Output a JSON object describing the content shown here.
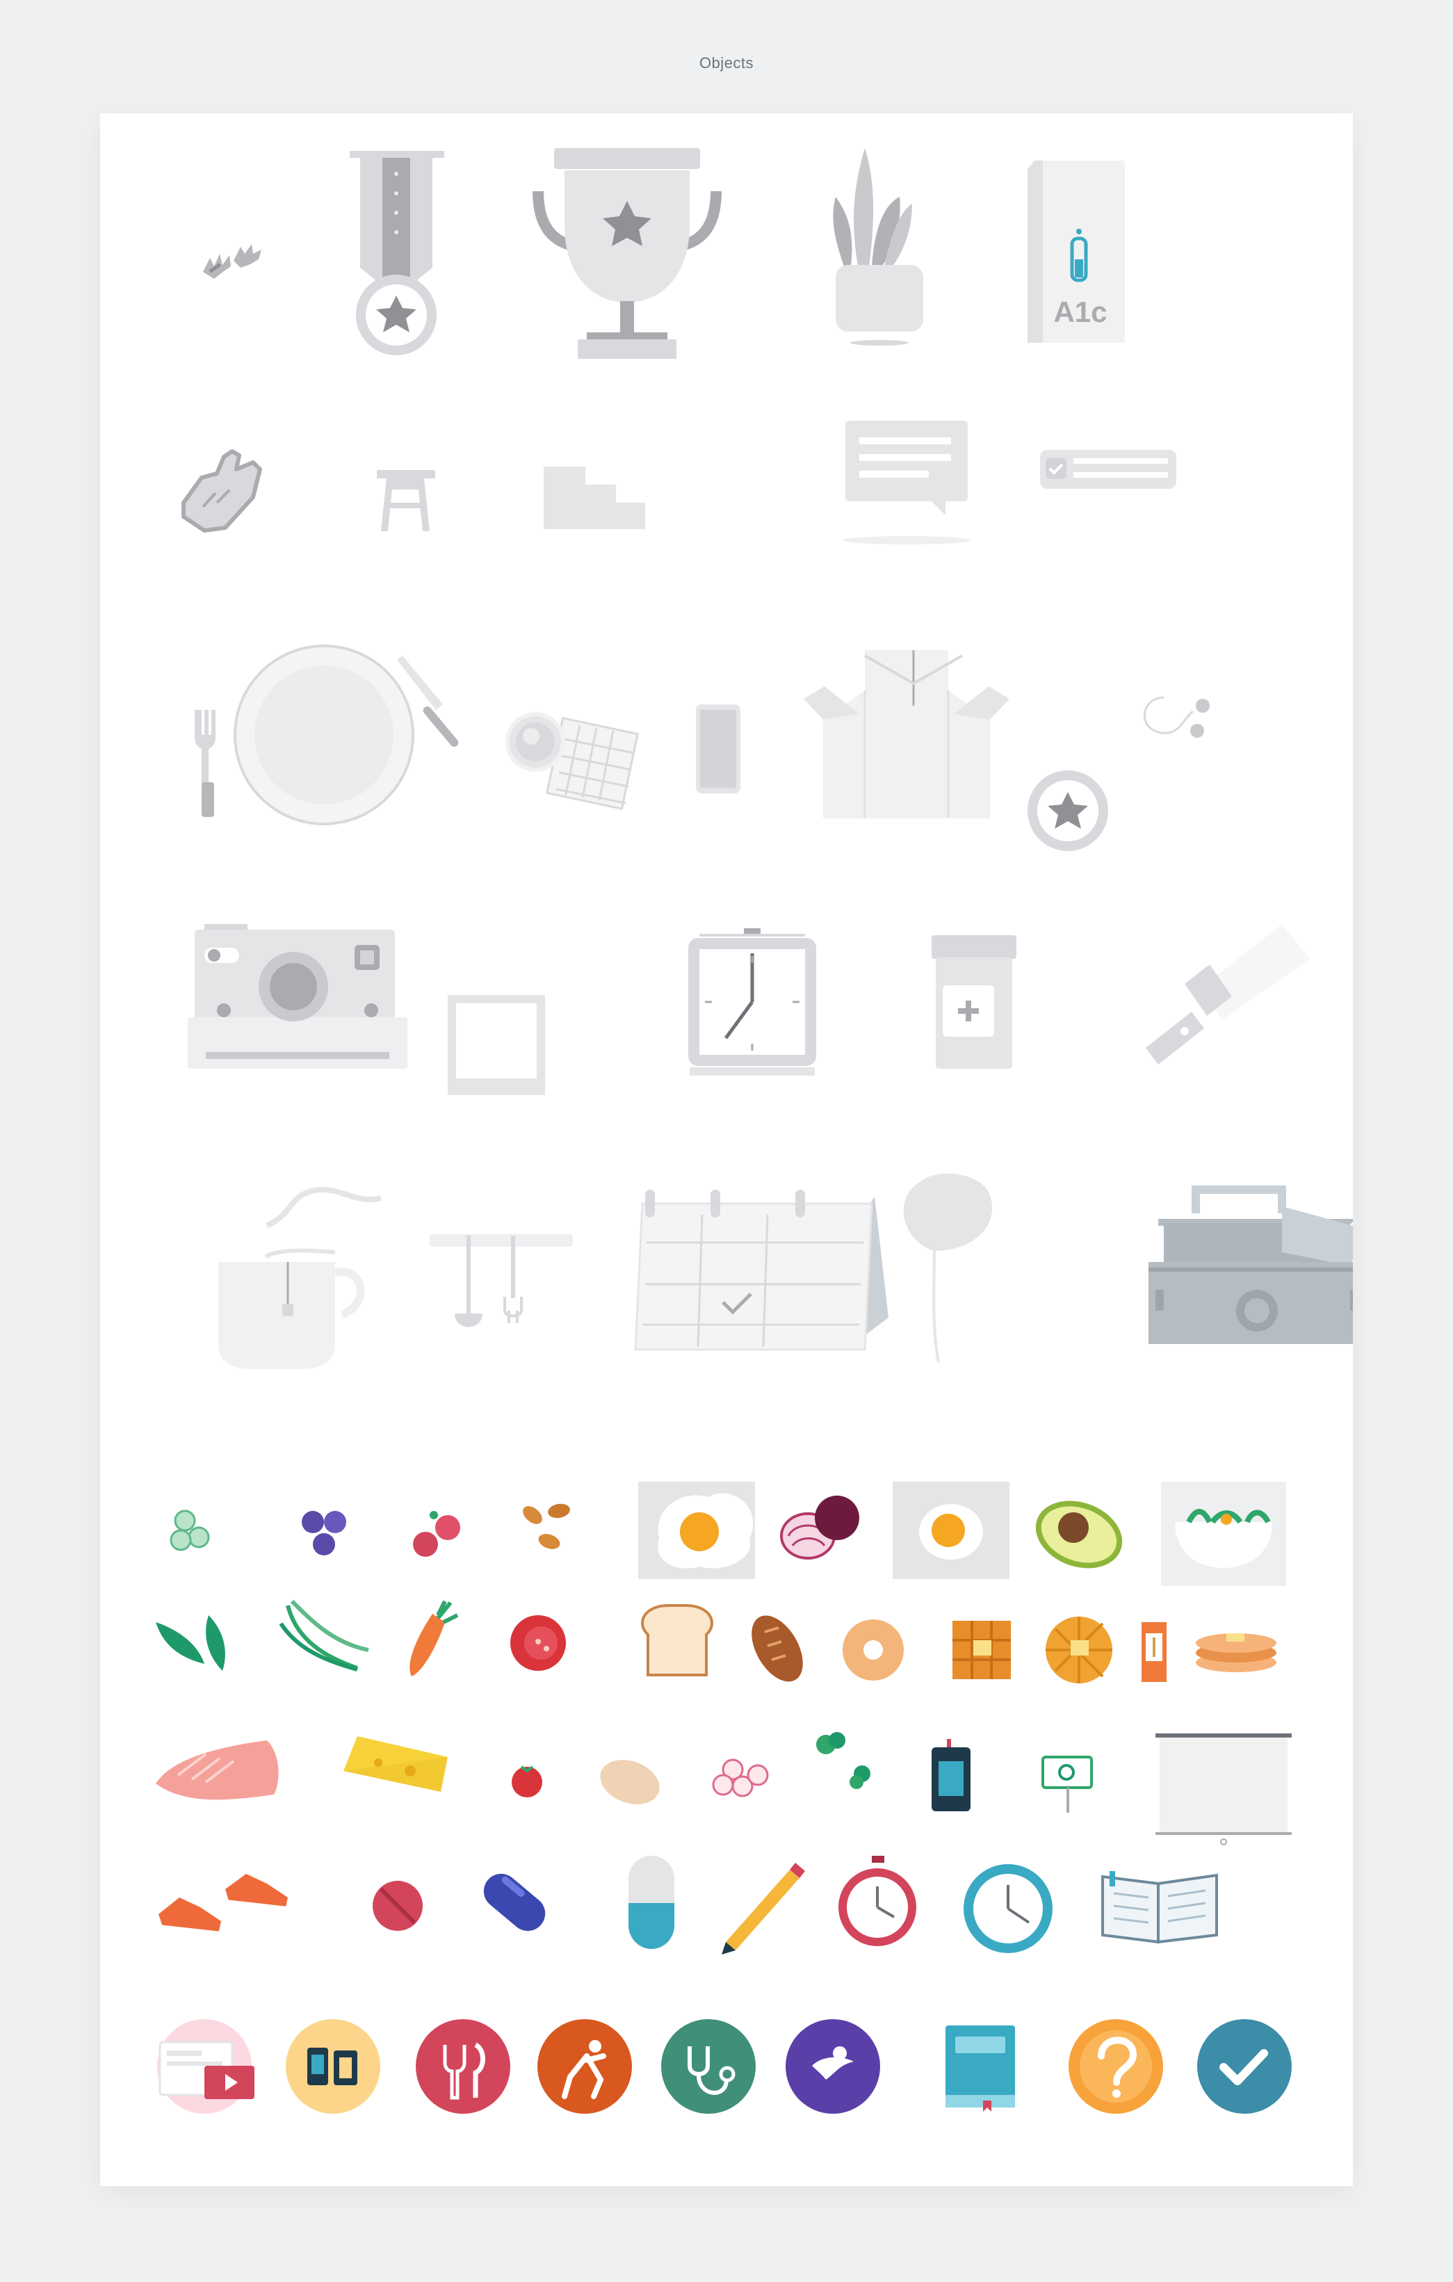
{
  "page": {
    "title": "Objects"
  },
  "labels": {
    "a1c_box": "A1c"
  },
  "colors": {
    "background": "#eef0f2",
    "sheet": "#ffffff",
    "gray_icon": "#d8d9dc",
    "gray_icon_dark": "#a9abae",
    "accent_teal": "#3aa9c4",
    "egg_yolk": "#f5a623",
    "red": "#d3455b",
    "orange": "#ef7a3a",
    "green": "#1e9a6a",
    "purple": "#5b4aa8",
    "blue_circle": "#3c8da8"
  },
  "rows": [
    [
      "pom-poms-icon",
      "medal-icon",
      "trophy-icon",
      "plant-pot-icon",
      "a1c-test-box-icon"
    ],
    [
      "foam-finger-icon",
      "stool-icon",
      "steps-icon",
      "chat-bubble-icon",
      "checklist-card-icon"
    ],
    [
      "fork-icon",
      "plate-icon",
      "knife-icon",
      "waffle-icon",
      "phone-icon",
      "jacket-icon",
      "earbuds-icon"
    ],
    [
      "instant-camera-icon",
      "photo-frame-icon",
      "alarm-clock-icon",
      "pill-bottle-icon",
      "flashlight-icon"
    ],
    [
      "tea-mug-icon",
      "utensil-rack-icon",
      "desk-calendar-icon",
      "monstera-leaf-icon",
      "lunch-box-icon"
    ],
    [
      "cucumber-slices-icon",
      "blueberries-icon",
      "raspberries-icon",
      "almonds-icon",
      "fried-egg-icon",
      "beet-onion-icon",
      "boiled-egg-icon",
      "avocado-icon",
      "salad-bowl-icon"
    ],
    [
      "pea-pods-icon",
      "green-beans-icon",
      "carrot-icon",
      "tomato-half-icon",
      "toast-icon",
      "bread-loaf-icon",
      "bagel-icon",
      "square-waffle-icon",
      "round-waffle-icon",
      "cereal-box-icon",
      "pancakes-icon"
    ],
    [
      "salmon-fillet-icon",
      "cheese-icon",
      "cherry-tomato-icon",
      "potato-icon",
      "radish-slices-icon",
      "broccoli-icon",
      "glucose-meter-icon",
      "sign-icon",
      "projector-screen-icon"
    ],
    [
      "sneakers-icon",
      "no-pill-icon",
      "blue-pill-icon",
      "capsule-icon",
      "pencil-icon",
      "stopwatch-icon",
      "wall-clock-icon",
      "open-book-icon"
    ],
    [
      "video-icon",
      "devices-icon",
      "meal-icon",
      "exercise-icon",
      "stethoscope-icon",
      "fitness-logo-icon",
      "guide-book-icon",
      "question-icon",
      "checkmark-icon"
    ]
  ]
}
